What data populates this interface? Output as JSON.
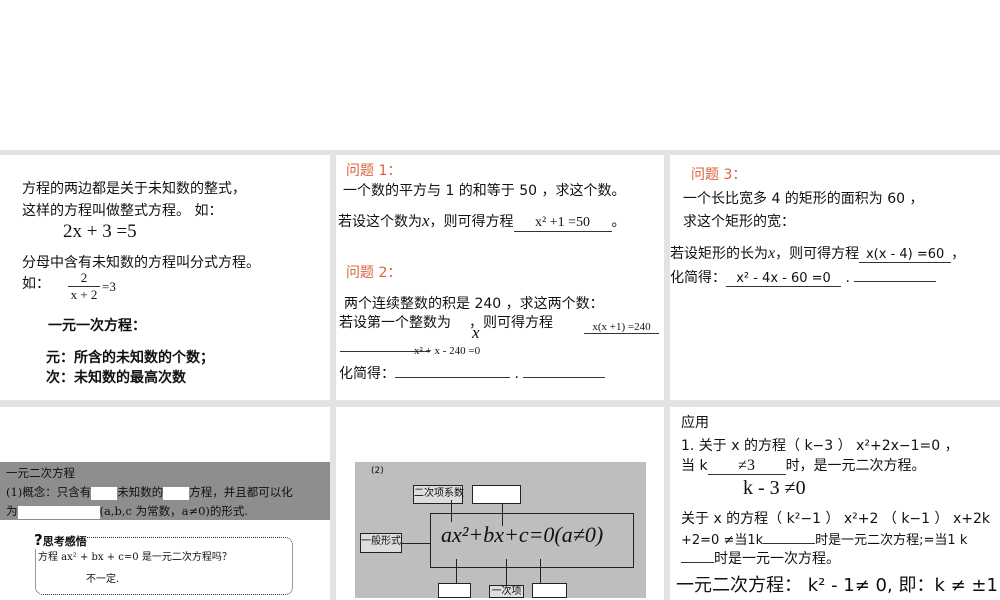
{
  "p1": {
    "l1": "方程的两边都是关于未知数的整式，",
    "l2": "这样的方程叫做整式方程。  如：",
    "eq1": "2x + 3 =5",
    "l3": "分母中含有未知数的方程叫分式方程。",
    "l4": "如：",
    "frac_num": "2",
    "frac_den": "x + 2",
    "frac_rhs": "=3",
    "h": "一元一次方程：",
    "yuan": "元：所含的未知数的个数；",
    "ci": "次：未知数的最高次数"
  },
  "p2": {
    "q1": "问题 1：",
    "q1_text": "一个数的平方与 1 的和等于 50 ，求这个数。",
    "q1_set": "若设这个数为",
    "x": "x",
    "q1_set2": "，则可得方程",
    "q1_ans": "x² +1 =50",
    "q1_end": "。",
    "q2": "问题 2：",
    "q2_text": "两个连续整数的积是 240 ，求这两个数：",
    "q2_set": "若设第一个整数为",
    "q2_set2": "，则可得方程",
    "q2_ans": "x(x +1) =240",
    "q2_ans2": "x² + x - 240 =0",
    "simp": "化简得：",
    "dot": "."
  },
  "p3": {
    "q3": "问题 3：",
    "l1": "一个长比宽多 4 的矩形的面积为 60 ，",
    "l2": "求这个矩形的宽：",
    "set": "若设矩形的长为",
    "x": "x",
    "set2": "，则可得方程",
    "ans": "x(x - 4) =60",
    "comma": "，",
    "simp": "化简得：",
    "ans2": "x² - 4x - 60 =0",
    "dot": "."
  },
  "p4": {
    "title": "一元二次方程",
    "l1a": "(1)概念：只含有",
    "l1b": "未知数的",
    "l1c": "方程，并且都可以化",
    "l2a": "为",
    "l2b": "(a,b,c 为常数，a≠0)的形式.",
    "think": "思考感悟",
    "q": "方程 ax² + bx + c=0 是一元二次方程吗？",
    "a": "不一定."
  },
  "p5": {
    "label": "(2)",
    "coef2": "二次项系数",
    "general": "一般形式",
    "eq": "ax²+bx+c=0(a≠0)",
    "linear": "一次项"
  },
  "p6": {
    "title": "应用",
    "l1": "1. 关于 x 的方程（ k−3 ） x²+2x−1=0 ，",
    "l2a": "当  k",
    "l2ans": "≠3",
    "l2b": "时，是一元二次方程。",
    "cond": "k - 3 ≠0",
    "l3": "关于 x 的方程（ k²−1 ） x²+2 （ k−1 ） x+2k",
    "l4a": "+2=0 ≠当1k",
    "l4b": "时是一元二次方程;=当1 k",
    "l5": "时是一元一次方程。",
    "l6": "一元二次方程：  k² - 1≠ 0,  即：k ≠ ±1"
  }
}
